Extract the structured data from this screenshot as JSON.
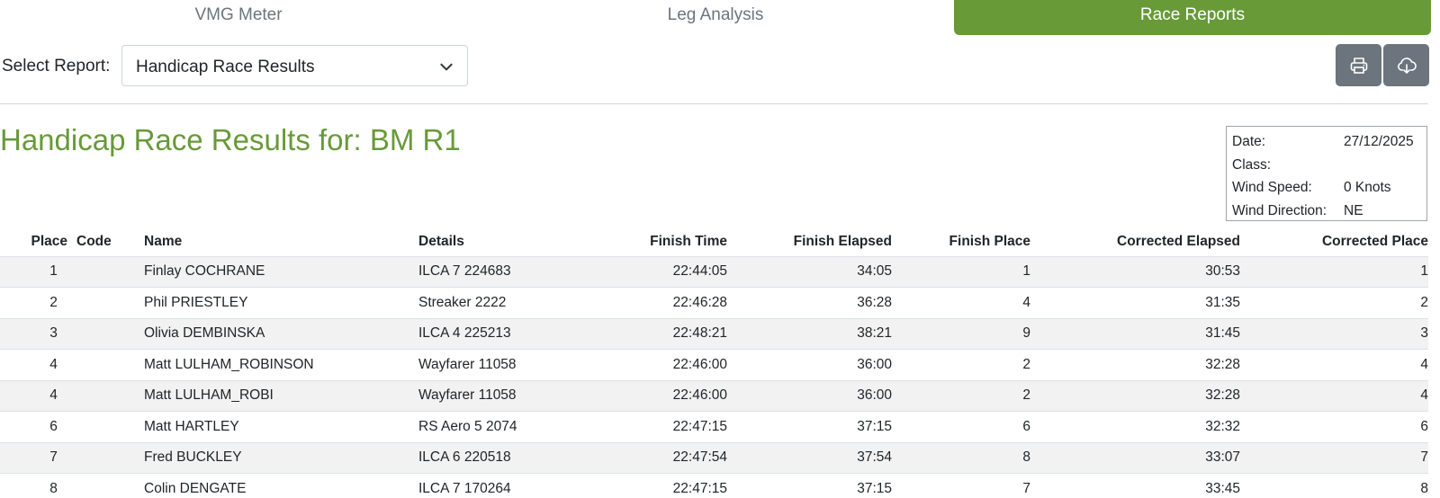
{
  "tabs": [
    {
      "label": "VMG Meter",
      "active": false
    },
    {
      "label": "Leg Analysis",
      "active": false
    },
    {
      "label": "Race Reports",
      "active": true
    }
  ],
  "report_select": {
    "label": "Select Report:",
    "value": "Handicap Race Results"
  },
  "toolbar": {
    "print_icon": "printer-icon",
    "download_icon": "cloud-download-icon",
    "button_color": "#6c757d"
  },
  "title": "Handicap Race Results for: BM R1",
  "colors": {
    "accent": "#689a38",
    "stripe": "#f2f2f2"
  },
  "race_info": [
    {
      "key": "Date:",
      "value": "27/12/2025"
    },
    {
      "key": "Class:",
      "value": ""
    },
    {
      "key": "Wind Speed:",
      "value": "0 Knots"
    },
    {
      "key": "Wind Direction:",
      "value": "NE"
    }
  ],
  "table": {
    "headers": [
      "Place",
      "Code",
      "Name",
      "Details",
      "Finish Time",
      "Finish Elapsed",
      "Finish Place",
      "Corrected Elapsed",
      "Corrected Place"
    ],
    "rows": [
      [
        "1",
        "",
        "Finlay COCHRANE",
        "ILCA 7 224683",
        "22:44:05",
        "34:05",
        "1",
        "30:53",
        "1"
      ],
      [
        "2",
        "",
        "Phil PRIESTLEY",
        "Streaker 2222",
        "22:46:28",
        "36:28",
        "4",
        "31:35",
        "2"
      ],
      [
        "3",
        "",
        "Olivia DEMBINSKA",
        "ILCA 4 225213",
        "22:48:21",
        "38:21",
        "9",
        "31:45",
        "3"
      ],
      [
        "4",
        "",
        "Matt LULHAM_ROBINSON",
        "Wayfarer 11058",
        "22:46:00",
        "36:00",
        "2",
        "32:28",
        "4"
      ],
      [
        "4",
        "",
        "Matt LULHAM_ROBI",
        "Wayfarer 11058",
        "22:46:00",
        "36:00",
        "2",
        "32:28",
        "4"
      ],
      [
        "6",
        "",
        "Matt HARTLEY",
        "RS Aero 5 2074",
        "22:47:15",
        "37:15",
        "6",
        "32:32",
        "6"
      ],
      [
        "7",
        "",
        "Fred BUCKLEY",
        "ILCA 6 220518",
        "22:47:54",
        "37:54",
        "8",
        "33:07",
        "7"
      ],
      [
        "8",
        "",
        "Colin DENGATE",
        "ILCA 7 170264",
        "22:47:15",
        "37:15",
        "7",
        "33:45",
        "8"
      ]
    ]
  }
}
